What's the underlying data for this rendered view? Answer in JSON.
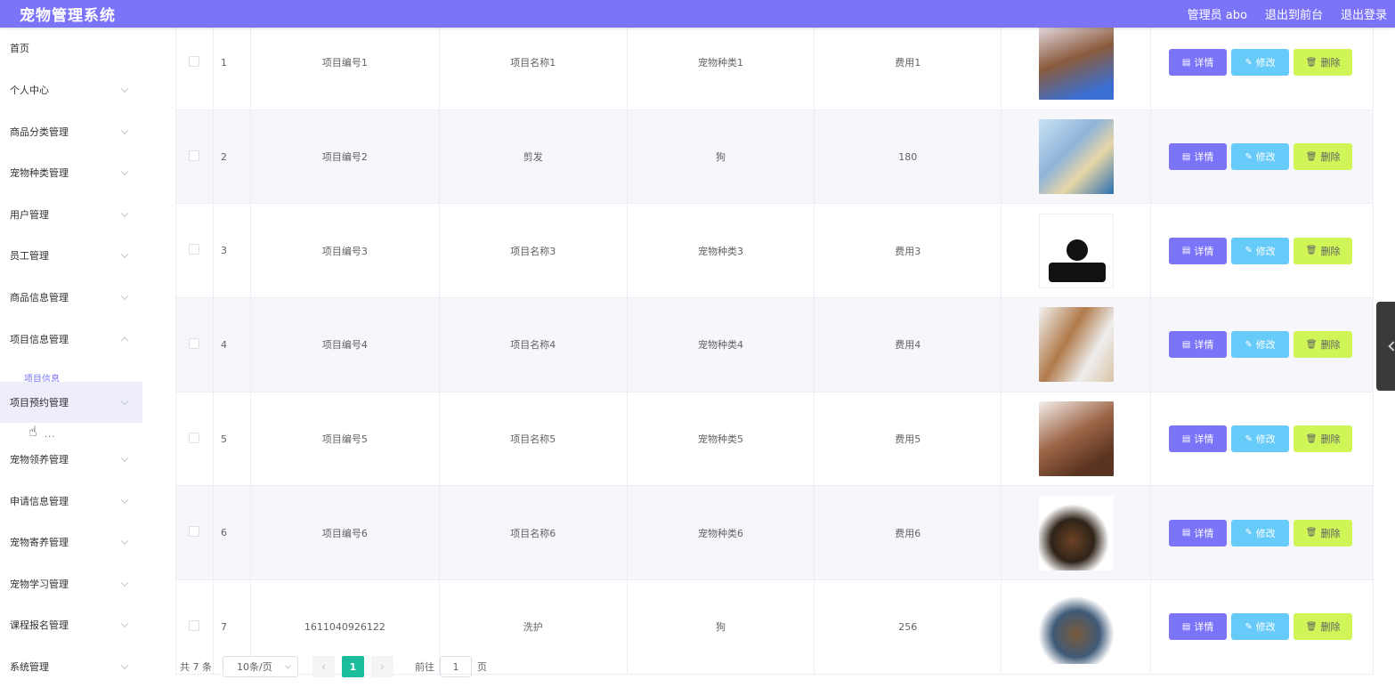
{
  "header": {
    "title": "宠物管理系统",
    "user": "管理员 abo",
    "frontend": "退出到前台",
    "logout": "退出登录"
  },
  "sidebar": {
    "items": [
      {
        "label": "首页"
      },
      {
        "label": "个人中心"
      },
      {
        "label": "商品分类管理"
      },
      {
        "label": "宠物种类管理"
      },
      {
        "label": "用户管理"
      },
      {
        "label": "员工管理"
      },
      {
        "label": "商品信息管理"
      },
      {
        "label": "项目信息管理"
      },
      {
        "label": "项目预约管理"
      },
      {
        "label": "宠物领养管理"
      },
      {
        "label": "申请信息管理"
      },
      {
        "label": "宠物寄养管理"
      },
      {
        "label": "宠物学习管理"
      },
      {
        "label": "课程报名管理"
      },
      {
        "label": "系统管理"
      }
    ],
    "sub_item": "项目信息",
    "hover_dots": "..."
  },
  "buttons": {
    "detail": "详情",
    "edit": "修改",
    "delete": "删除"
  },
  "table": {
    "rows": [
      {
        "idx": "1",
        "code": "项目编号1",
        "name": "项目名称1",
        "kind": "宠物种类1",
        "fee": "费用1"
      },
      {
        "idx": "2",
        "code": "项目编号2",
        "name": "剪发",
        "kind": "狗",
        "fee": "180"
      },
      {
        "idx": "3",
        "code": "项目编号3",
        "name": "项目名称3",
        "kind": "宠物种类3",
        "fee": "费用3"
      },
      {
        "idx": "4",
        "code": "项目编号4",
        "name": "项目名称4",
        "kind": "宠物种类4",
        "fee": "费用4"
      },
      {
        "idx": "5",
        "code": "项目编号5",
        "name": "项目名称5",
        "kind": "宠物种类5",
        "fee": "费用5"
      },
      {
        "idx": "6",
        "code": "项目编号6",
        "name": "项目名称6",
        "kind": "宠物种类6",
        "fee": "费用6"
      },
      {
        "idx": "7",
        "code": "1611040926122",
        "name": "洗护",
        "kind": "狗",
        "fee": "256"
      }
    ]
  },
  "pagination": {
    "total": "共 7 条",
    "page_size": "10条/页",
    "current": "1",
    "goto_label": "前往",
    "goto_value": "1",
    "page_suffix": "页"
  },
  "colors": {
    "accent": "#7b74f8",
    "edit": "#67cbf9",
    "delete": "#cff556",
    "page": "#1abc9c"
  }
}
